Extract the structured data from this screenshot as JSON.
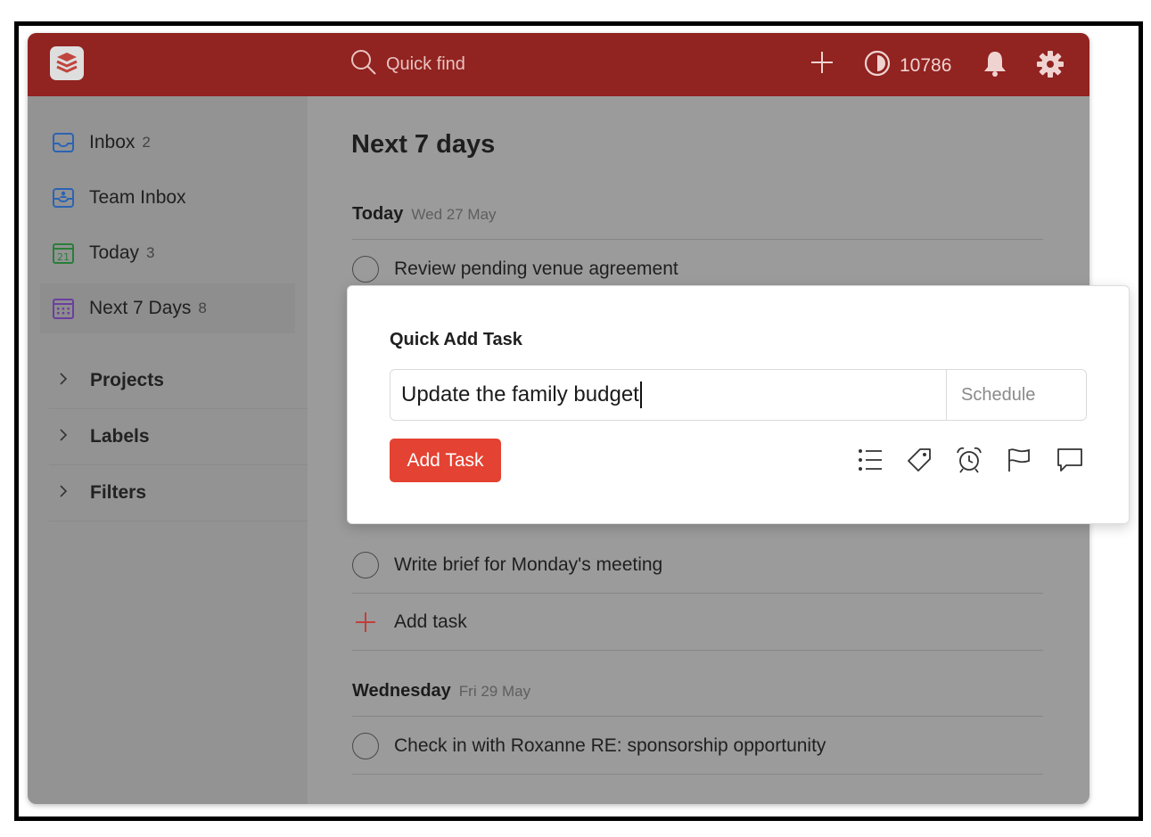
{
  "topbar": {
    "search_placeholder": "Quick find",
    "karma_count": "10786",
    "brand_color": "#912320"
  },
  "sidebar": {
    "items": [
      {
        "label": "Inbox",
        "count": "2",
        "icon": "inbox-icon"
      },
      {
        "label": "Team Inbox",
        "count": "",
        "icon": "team-inbox-icon"
      },
      {
        "label": "Today",
        "count": "3",
        "icon": "calendar-today-icon",
        "icon_text": "21"
      },
      {
        "label": "Next 7 Days",
        "count": "8",
        "icon": "calendar-week-icon"
      }
    ],
    "sections": [
      {
        "label": "Projects"
      },
      {
        "label": "Labels"
      },
      {
        "label": "Filters"
      }
    ]
  },
  "main": {
    "title": "Next 7 days",
    "days": [
      {
        "name": "Today",
        "date": "Wed 27 May"
      },
      {
        "name": "Wednesday",
        "date": "Fri 29 May"
      }
    ],
    "tasks": [
      "Review pending venue agreement",
      "Write brief for Monday's meeting",
      "Check in with Roxanne RE: sponsorship opportunity"
    ],
    "add_task_label": "Add task"
  },
  "dialog": {
    "title": "Quick Add Task",
    "input_value": "Update the family budget",
    "schedule_label": "Schedule",
    "add_button_label": "Add Task",
    "accent_color": "#e44232",
    "tools": [
      "project-list-icon",
      "label-tag-icon",
      "reminder-alarm-icon",
      "priority-flag-icon",
      "comment-icon"
    ]
  }
}
